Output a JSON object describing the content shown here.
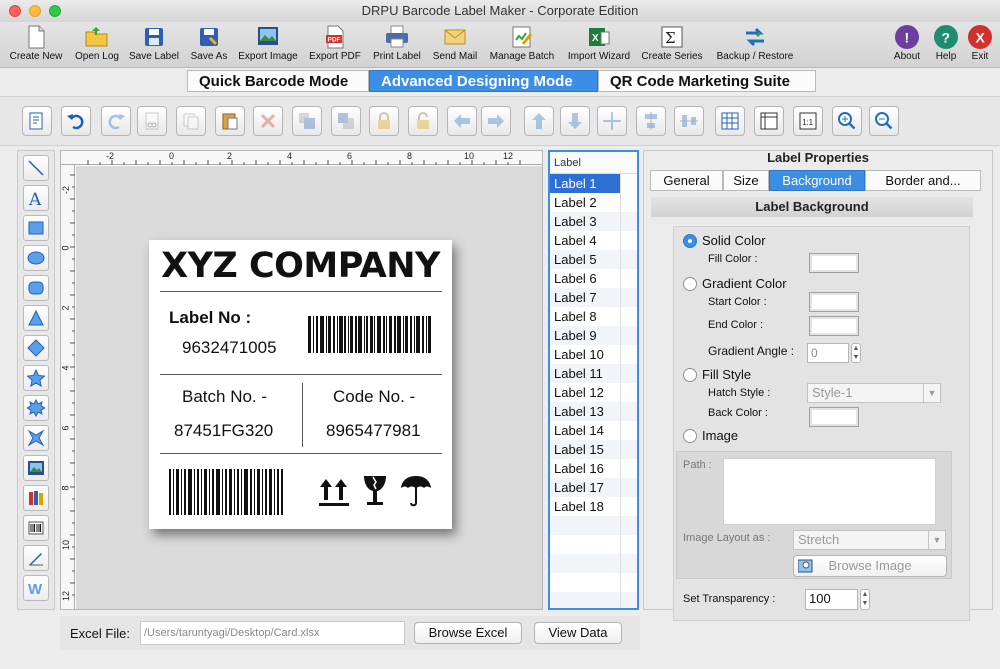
{
  "window": {
    "title": "DRPU Barcode Label Maker - Corporate Edition"
  },
  "toolbar": {
    "items": [
      {
        "label": "Create New",
        "icon": "new-document-icon"
      },
      {
        "label": "Open Log",
        "icon": "open-folder-icon"
      },
      {
        "label": "Save Label",
        "icon": "save-disk-icon"
      },
      {
        "label": "Save As",
        "icon": "save-as-icon"
      },
      {
        "label": "Export Image",
        "icon": "export-image-icon"
      },
      {
        "label": "Export PDF",
        "icon": "pdf-icon"
      },
      {
        "label": "Print Label",
        "icon": "printer-icon"
      },
      {
        "label": "Send Mail",
        "icon": "mail-icon"
      },
      {
        "label": "Manage Batch",
        "icon": "manage-batch-icon"
      },
      {
        "label": "Import Wizard",
        "icon": "import-wizard-icon"
      },
      {
        "label": "Create Series",
        "icon": "sigma-icon"
      },
      {
        "label": "Backup / Restore",
        "icon": "backup-arrows-icon"
      }
    ],
    "right_items": [
      {
        "label": "About",
        "icon": "about-icon",
        "color": "#6b3fa0"
      },
      {
        "label": "Help",
        "icon": "help-icon",
        "color": "#1e8c6e"
      },
      {
        "label": "Exit",
        "icon": "exit-icon",
        "color": "#d0312d"
      }
    ]
  },
  "modes": {
    "quick": "Quick Barcode Mode",
    "advanced": "Advanced Designing Mode",
    "qr": "QR Code Marketing Suite",
    "active": "advanced"
  },
  "ruler": {
    "h_ticks": [
      "-2",
      "0",
      "2",
      "4",
      "6",
      "8",
      "10",
      "12"
    ],
    "v_ticks": [
      "-2",
      "0",
      "2",
      "4",
      "6",
      "8",
      "10",
      "12"
    ]
  },
  "label": {
    "company": "XYZ COMPANY",
    "label_no_title": "Label No :",
    "label_no_value": "9632471005",
    "batch_title": "Batch No. -",
    "batch_value": "87451FG320",
    "code_title": "Code No. -",
    "code_value": "8965477981"
  },
  "label_list": {
    "header": "Label",
    "items": [
      "Label 1",
      "Label 2",
      "Label 3",
      "Label 4",
      "Label 5",
      "Label 6",
      "Label 7",
      "Label 8",
      "Label 9",
      "Label 10",
      "Label 11",
      "Label 12",
      "Label 13",
      "Label 14",
      "Label 15",
      "Label 16",
      "Label 17",
      "Label 18"
    ],
    "selected_index": 0
  },
  "properties": {
    "title": "Label Properties",
    "tabs": [
      "General",
      "Size",
      "Background",
      "Border and..."
    ],
    "active_tab": "Background",
    "section_title": "Label Background",
    "solid_color": "Solid Color",
    "fill_color": "Fill Color :",
    "gradient_color": "Gradient Color",
    "start_color": "Start Color :",
    "end_color": "End Color :",
    "gradient_angle": "Gradient Angle :",
    "gradient_angle_value": "0",
    "fill_style": "Fill Style",
    "hatch_style": "Hatch Style :",
    "hatch_style_value": "Style-1",
    "back_color": "Back Color :",
    "image": "Image",
    "path": "Path :",
    "image_layout": "Image Layout as :",
    "image_layout_value": "Stretch",
    "browse_image": "Browse Image",
    "transparency": "Set Transparency :",
    "transparency_value": "100"
  },
  "bottom": {
    "excel_label": "Excel File:",
    "excel_path": "/Users/taruntyagi/Desktop/Card.xlsx",
    "browse_excel": "Browse Excel",
    "view_data": "View Data"
  },
  "colors": {
    "accent": "#3a8ee6",
    "selection": "#2d6fd2"
  }
}
